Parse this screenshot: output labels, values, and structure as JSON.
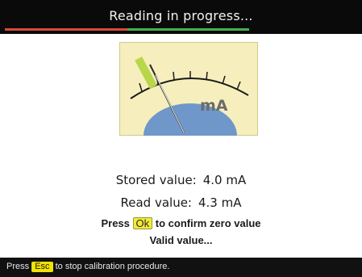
{
  "header": {
    "title": "Reading in progress...",
    "progress_fraction": 0.5,
    "colors": {
      "track": "#d84a3a",
      "fill": "#43b24a"
    }
  },
  "gauge": {
    "unit_label": "mA",
    "colors": {
      "panel": "#f6efbd",
      "border": "#cfc98a",
      "dial": "#6f97c9",
      "needle_tip": "#b7d64a"
    }
  },
  "readings": {
    "stored_label": "Stored value:",
    "stored_value": "4.0 mA",
    "read_label": "Read value:",
    "read_value": "4.3 mA"
  },
  "hint": {
    "prefix": "Press",
    "key": "Ok",
    "suffix": "to confirm zero value"
  },
  "status_text": "Valid value...",
  "footer": {
    "prefix": "Press",
    "key": "Esc",
    "suffix": "to stop calibration procedure."
  }
}
